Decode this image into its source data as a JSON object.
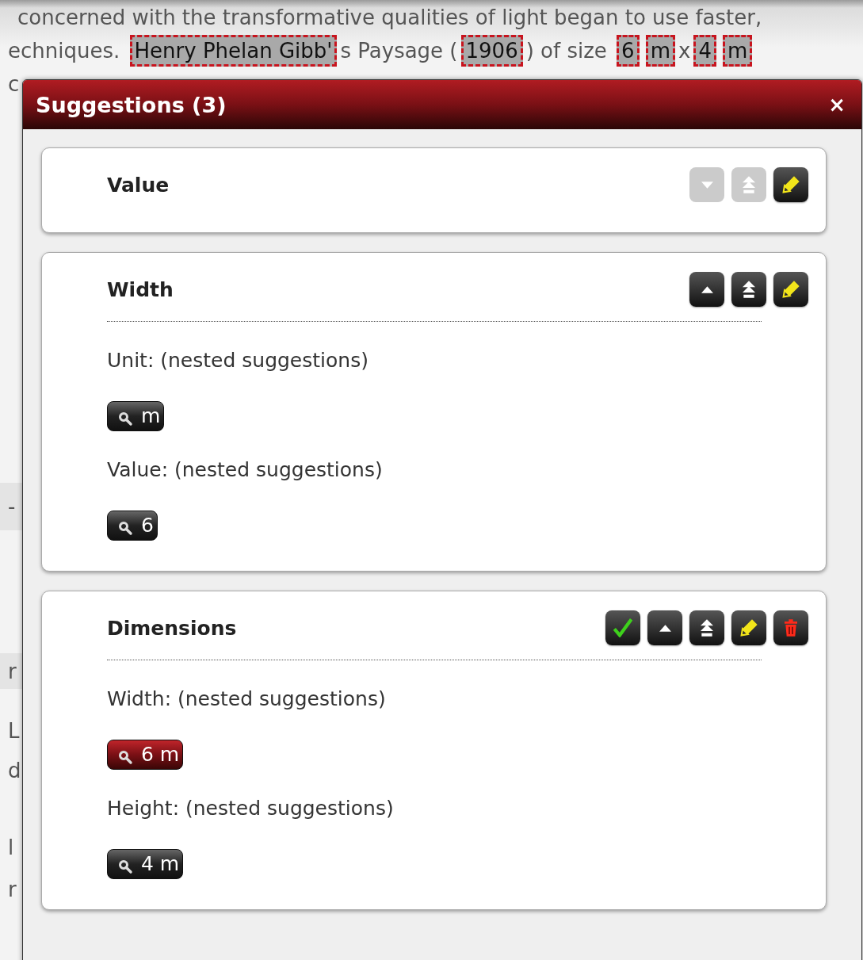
{
  "background": {
    "line_1": "concerned with the transformative qualities of light began to use faster,",
    "line_2": [
      {
        "text": "echniques. ",
        "marked": false
      },
      {
        "text": "Henry Phelan Gibb'",
        "marked": true
      },
      {
        "text": "s Paysage (",
        "marked": false
      },
      {
        "text": "1906",
        "marked": true
      },
      {
        "text": ") of size ",
        "marked": false
      },
      {
        "text": "6",
        "marked": true
      },
      {
        "text": "m",
        "marked": true
      },
      {
        "text": "x",
        "marked": false
      },
      {
        "text": "4",
        "marked": true
      },
      {
        "text": "m",
        "marked": true
      }
    ],
    "edge_fragments": [
      {
        "text": "c",
        "kind": "plain"
      },
      {
        "text": "-",
        "kind": "band"
      },
      {
        "text": "r",
        "kind": "band"
      },
      {
        "text": "L",
        "kind": "plain"
      },
      {
        "text": "d",
        "kind": "plain"
      },
      {
        "text": "l",
        "kind": "plain"
      },
      {
        "text": "r",
        "kind": "plain"
      }
    ]
  },
  "dialog": {
    "title": "Suggestions (3)",
    "close": "×",
    "cards": [
      {
        "title": "Value",
        "buttons": [
          {
            "kind": "down",
            "disabled": true
          },
          {
            "kind": "top",
            "disabled": true
          },
          {
            "kind": "edit",
            "disabled": false
          }
        ]
      },
      {
        "title": "Width",
        "buttons": [
          {
            "kind": "up",
            "disabled": false
          },
          {
            "kind": "top",
            "disabled": false
          },
          {
            "kind": "edit",
            "disabled": false
          }
        ],
        "fields": [
          {
            "label": "Unit: (nested suggestions)",
            "suggestions": [
              {
                "value": "m",
                "selected": false
              }
            ]
          },
          {
            "label": "Value: (nested suggestions)",
            "suggestions": [
              {
                "value": "6",
                "selected": false
              }
            ]
          }
        ]
      },
      {
        "title": "Dimensions",
        "buttons": [
          {
            "kind": "accept",
            "disabled": false
          },
          {
            "kind": "up",
            "disabled": false
          },
          {
            "kind": "top",
            "disabled": false
          },
          {
            "kind": "edit",
            "disabled": false
          },
          {
            "kind": "delete",
            "disabled": false
          }
        ],
        "fields": [
          {
            "label": "Width: (nested suggestions)",
            "suggestions": [
              {
                "value": "6 m",
                "selected": true
              }
            ]
          },
          {
            "label": "Height: (nested suggestions)",
            "suggestions": [
              {
                "value": "4 m",
                "selected": false
              }
            ]
          }
        ]
      }
    ]
  }
}
